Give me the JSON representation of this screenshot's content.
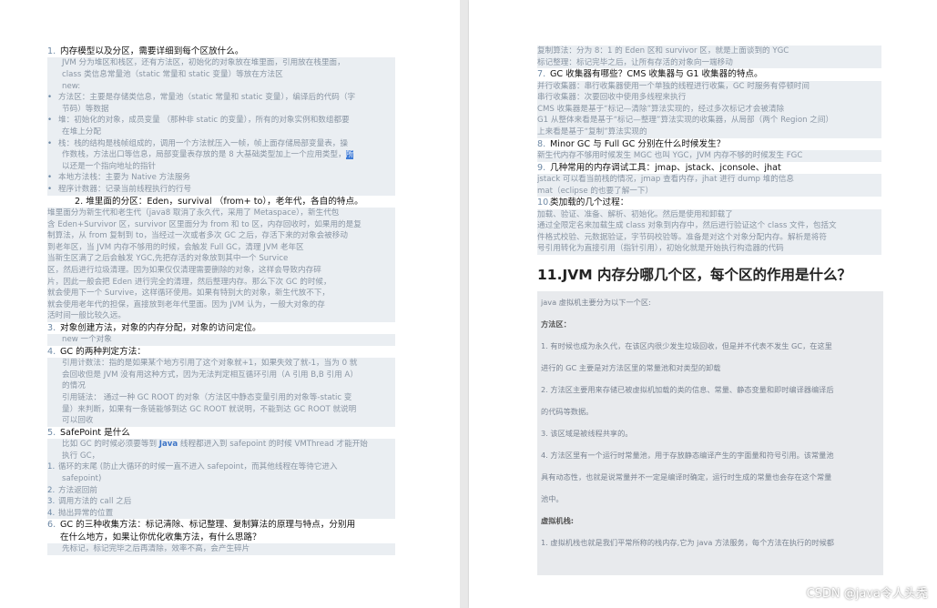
{
  "left": {
    "items": [
      {
        "cls": "q",
        "num": "1.",
        "text": "内存模型以及分区，需要详细到每个区放什么。"
      },
      {
        "cls": "a",
        "text": "JVM 分为堆区和栈区，还有方法区，初始化的对象放在堆里面，引用放在栈里面，"
      },
      {
        "cls": "a",
        "text": "class 类信息常量池（static 常量和 static 变量）等放在方法区"
      },
      {
        "cls": "a",
        "text": "new:"
      },
      {
        "cls": "bullet",
        "text": "方法区：主要是存储类信息，常量池（static 常量和 static 变量），编译后的代码（字"
      },
      {
        "cls": "a",
        "text": "节码）等数据"
      },
      {
        "cls": "bullet",
        "text": "堆：初始化的对象，成员变量 （那种非 static 的变量），所有的对象实例和数组都要"
      },
      {
        "cls": "a",
        "text": "在堆上分配"
      },
      {
        "cls": "bullet",
        "text": "栈：栈的结构是栈帧组成的，调用一个方法就压入一帧，帧上面存储局部变量表，操"
      },
      {
        "cls": "a",
        "text": "作数栈，方法出口等信息，局部变量表存放的是 8 大基础类型加上一个应用类型，",
        "hl": "所"
      },
      {
        "cls": "a",
        "text": "以还是一个指向地址的指针"
      },
      {
        "cls": "bullet",
        "text": "本地方法栈：主要为 Native 方法服务"
      },
      {
        "cls": "bullet",
        "text": "程序计数器：记录当前线程执行的行号"
      },
      {
        "cls": "q center",
        "text": "2.  堆里面的分区：Eden，survival （from+ to），老年代，各自的特点。"
      },
      {
        "cls": "b",
        "text": "堆里面分为新生代和老生代（java8 取消了永久代，采用了 Metaspace），新生代包"
      },
      {
        "cls": "b",
        "text": "含 Eden+Survivor 区，survivor 区里面分为 from 和 to 区，内存回收时，如果用的是复"
      },
      {
        "cls": "b",
        "text": "制算法，从 from 复制到 to，当经过一次或者多次 GC 之后，存活下来的对象会被移动"
      },
      {
        "cls": "b",
        "text": "到老年区，当 JVM 内存不够用的时候，会触发 Full GC，清理 JVM 老年区"
      },
      {
        "cls": "b",
        "text": "当新生区满了之后会触发 YGC,先把存活的对象放到其中一个 Survice"
      },
      {
        "cls": "b",
        "text": "区，然后进行垃圾清理。因为如果仅仅清理需要删除的对象，这样会导致内存碎"
      },
      {
        "cls": "b",
        "text": "片，因此一般会把 Eden 进行完全的清理，然后整理内存。那么下次 GC 的时候，"
      },
      {
        "cls": "b",
        "text": "就会使用下一个 Survive，这样循环使用。如果有特别大的对象，新生代放不下，"
      },
      {
        "cls": "b",
        "text": "就会使用老年代的担保，直接放到老年代里面。因为 JVM 认为，一般大对象的存"
      },
      {
        "cls": "b",
        "text": "活时间一般比较久远。"
      },
      {
        "cls": "q",
        "num": "3.",
        "text": "对象创建方法，对象的内存分配，对象的访问定位。"
      },
      {
        "cls": "a",
        "text": "new 一个对象"
      },
      {
        "cls": "q",
        "num": "4.",
        "text": "GC 的两种判定方法："
      },
      {
        "cls": "a",
        "text": "引用计数法：指的是如果某个地方引用了这个对象就+1，如果失效了就-1，当为 0 就"
      },
      {
        "cls": "a",
        "text": "会回收但是 JVM 没有用这种方式，因为无法判定相互循环引用（A 引用 B,B 引用 A）"
      },
      {
        "cls": "a",
        "text": "的情况"
      },
      {
        "cls": "a",
        "text": "引用链法： 通过一种 GC ROOT 的对象（方法区中静态变量引用的对象等-static 变"
      },
      {
        "cls": "a",
        "text": "量）来判断，如果有一条链能够到达 GC ROOT 就说明，不能到达 GC ROOT 就说明"
      },
      {
        "cls": "a",
        "text": "可以回收"
      },
      {
        "cls": "q",
        "num": "5.",
        "text": "SafePoint 是什么"
      },
      {
        "cls": "a",
        "text": "比如 GC 的时候必须要等到 Java 线程都进入到 safepoint 的时候 VMThread 才能开始",
        "link": "Java"
      },
      {
        "cls": "a",
        "text": "执行 GC，"
      },
      {
        "cls": "bullet",
        "n": "1.",
        "text": "循环的末尾 (防止大循环的时候一直不进入 safepoint，而其他线程在等待它进入"
      },
      {
        "cls": "a",
        "text": "safepoint)"
      },
      {
        "cls": "bullet",
        "n": "2.",
        "text": "方法返回前"
      },
      {
        "cls": "bullet",
        "n": "3.",
        "text": "调用方法的 call 之后"
      },
      {
        "cls": "bullet",
        "n": "4.",
        "text": "抛出异常的位置"
      },
      {
        "cls": "q",
        "num": "6.",
        "text": "GC 的三种收集方法：标记清除、标记整理、复制算法的原理与特点，分别用"
      },
      {
        "cls": "q",
        "text": "在什么地方，如果让你优化收集方法，有什么思路？",
        "indent": true
      },
      {
        "cls": "a",
        "text": "先标记，标记完毕之后再清除，效率不高，会产生碎片"
      }
    ]
  },
  "right": {
    "items": [
      {
        "cls": "b",
        "text": "复制算法：分为 8：1 的 Eden 区和 survivor 区，就是上面谈到的 YGC"
      },
      {
        "cls": "b",
        "text": "标记整理：标记完毕之后，让所有存活的对象向一端移动"
      },
      {
        "cls": "q",
        "num": "7.",
        "text": "GC 收集器有哪些？CMS 收集器与 G1 收集器的特点。"
      },
      {
        "cls": "b",
        "text": "并行收集器：串行收集器使用一个单独的线程进行收集，GC 时服务有停顿时间"
      },
      {
        "cls": "b",
        "text": "串行收集器：次要回收中使用多线程来执行"
      },
      {
        "cls": "b",
        "text": "CMS 收集器是基于“标记—清除”算法实现的，经过多次标记才会被清除"
      },
      {
        "cls": "b",
        "text": "G1 从整体来看是基于“标记—整理”算法实现的收集器，从局部（两个 Region 之间）"
      },
      {
        "cls": "b",
        "text": "上来看是基于“复制”算法实现的"
      },
      {
        "cls": "q",
        "num": "8.",
        "text": "Minor GC 与 Full GC 分别在什么时候发生？"
      },
      {
        "cls": "b",
        "text": "新生代内存不够用时候发生 MGC 也叫 YGC，JVM 内存不够的时候发生 FGC"
      },
      {
        "cls": "q",
        "num": "9.",
        "text": "几种常用的内存调试工具：jmap、jstack、jconsole、jhat"
      },
      {
        "cls": "b",
        "text": "jstack 可以看当前栈的情况，jmap 查看内存，jhat 进行 dump 堆的信息"
      },
      {
        "cls": "b",
        "text": "mat（eclipse 的也要了解一下）"
      },
      {
        "cls": "q",
        "num": "10.",
        "text": "类加载的几个过程："
      },
      {
        "cls": "b",
        "text": "加载、验证、准备、解析、初始化。然后是使用和卸载了"
      },
      {
        "cls": "b",
        "text": "通过全限定名来加载生成 class 对象到内存中，然后进行验证这个 class 文件，包括文"
      },
      {
        "cls": "b",
        "text": "件格式校验、元数据验证，字节码校验等。准备是对这个对象分配内存。解析是将符"
      },
      {
        "cls": "b",
        "text": "号引用转化为直接引用（指针引用），初始化就是开始执行构造器的代码"
      }
    ],
    "big_title": "11.JVM 内存分哪几个区，每个区的作用是什么？",
    "block": [
      {
        "t": "p",
        "text": "java 虚拟机主要分为以下一个区:"
      },
      {
        "t": "h",
        "text": "方法区："
      },
      {
        "t": "p",
        "text": "1. 有时候也成为永久代，在该区内很少发生垃圾回收，但是并不代表不发生 GC，在这里"
      },
      {
        "t": "p",
        "text": "进行的 GC 主要是对方法区里的常量池和对类型的卸载"
      },
      {
        "t": "p",
        "text": "2. 方法区主要用来存储已被虚拟机加载的类的信息、常量、静态变量和即时编译器编译后"
      },
      {
        "t": "p",
        "text": "的代码等数据。"
      },
      {
        "t": "p",
        "text": "3. 该区域是被线程共享的。"
      },
      {
        "t": "p",
        "text": "4. 方法区里有一个运行时常量池，用于存放静态编译产生的字面量和符号引用。该常量池"
      },
      {
        "t": "p",
        "text": "具有动态性，也就是说常量并不一定是编译时确定，运行时生成的常量也会存在这个常量"
      },
      {
        "t": "p",
        "text": "池中。"
      },
      {
        "t": "h",
        "text": "虚拟机栈:"
      },
      {
        "t": "p",
        "text": "1. 虚拟机栈也就是我们平常所称的栈内存,它为 java 方法服务，每个方法在执行的时候都"
      }
    ]
  },
  "watermark": "CSDN @java令人头秃"
}
